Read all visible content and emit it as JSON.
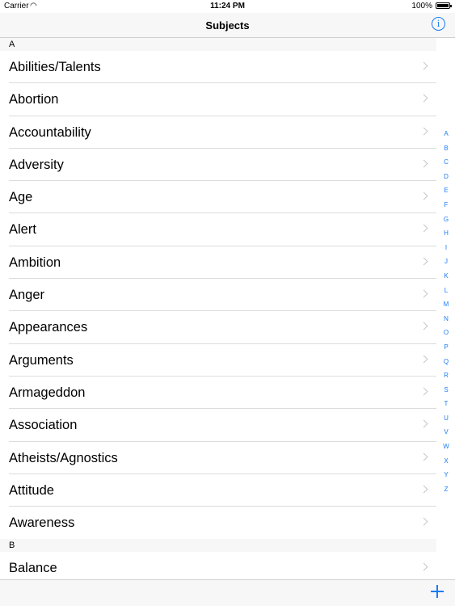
{
  "status_bar": {
    "carrier": "Carrier",
    "time": "11:24 PM",
    "battery": "100%"
  },
  "nav": {
    "title": "Subjects",
    "info_icon": "info-icon"
  },
  "sections": [
    {
      "header": "A",
      "items": [
        "Abilities/Talents",
        "Abortion",
        "Accountability",
        "Adversity",
        "Age",
        "Alert",
        "Ambition",
        "Anger",
        "Appearances",
        "Arguments",
        "Armageddon",
        "Association",
        "Atheists/Agnostics",
        "Attitude",
        "Awareness"
      ]
    },
    {
      "header": "B",
      "items": [
        "Balance"
      ]
    }
  ],
  "index": [
    "A",
    "B",
    "C",
    "D",
    "E",
    "F",
    "G",
    "H",
    "I",
    "J",
    "K",
    "L",
    "M",
    "N",
    "O",
    "P",
    "Q",
    "R",
    "S",
    "T",
    "U",
    "V",
    "W",
    "X",
    "Y",
    "Z"
  ],
  "toolbar": {
    "add_icon": "plus-icon"
  },
  "colors": {
    "accent": "#1a7cf5",
    "bar_background": "#f7f7f7",
    "separator": "#dcdcdc",
    "chevron": "#c7c7cc"
  }
}
